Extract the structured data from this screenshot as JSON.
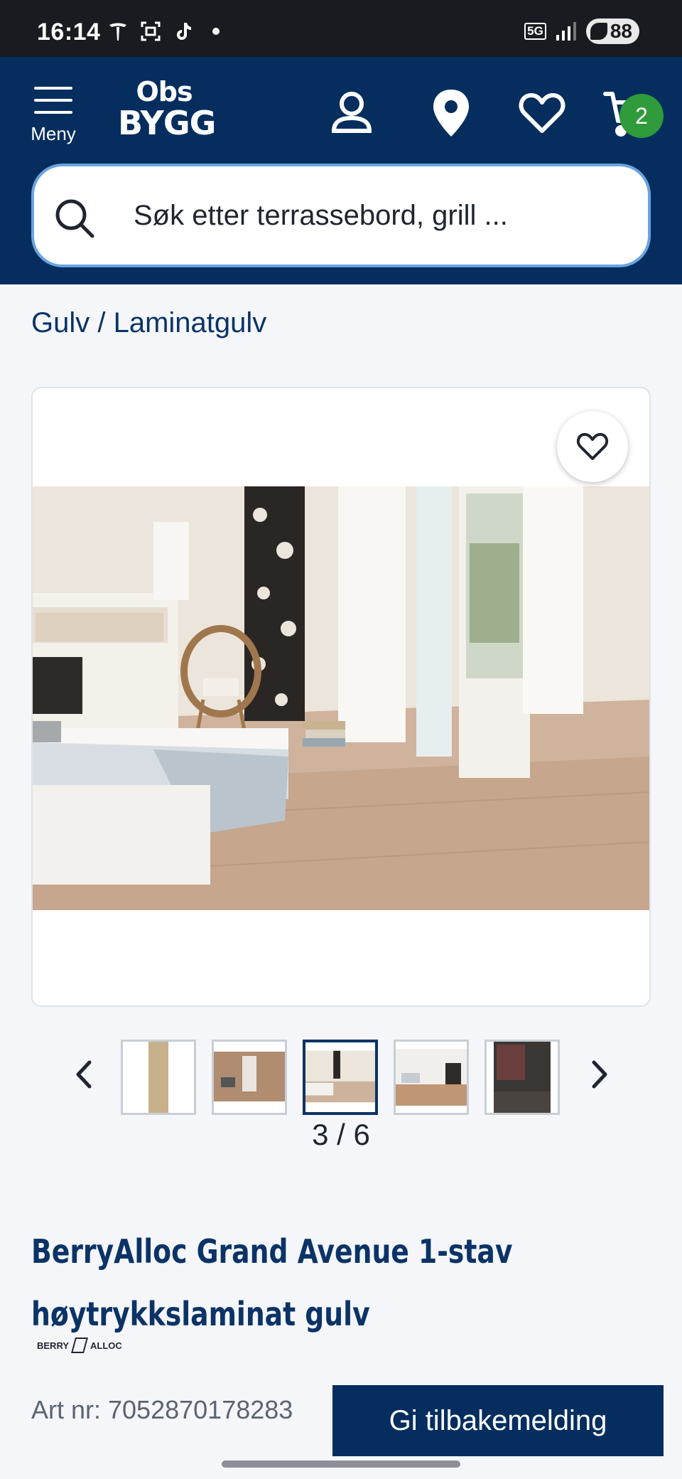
{
  "status_bar": {
    "time": "16:14",
    "left_icons": [
      "tesla-icon",
      "scan-icon",
      "tiktok-icon",
      "dot-icon"
    ],
    "network": "5G",
    "battery": "88"
  },
  "header": {
    "menu_label": "Meny",
    "logo_line1": "Obs",
    "logo_line2": "BYGG",
    "cart_count": "2",
    "accent_color": "#052e5f",
    "badge_color": "#2f9b3a"
  },
  "search": {
    "placeholder": "Søk etter terrassebord, grill ..."
  },
  "breadcrumb": {
    "items": [
      "Gulv",
      "Laminatgulv"
    ],
    "separator": " / "
  },
  "gallery": {
    "counter": "3 / 6",
    "current_index": 3,
    "total": 6,
    "thumbnails": [
      "plank-sample",
      "person-on-floor",
      "bedroom",
      "living-room",
      "dark-room"
    ]
  },
  "product": {
    "title_line1": "BerryAlloc Grand Avenue 1-stav",
    "title_line2": "høytrykkslaminat gulv",
    "brand_left": "BERRY",
    "brand_right": "ALLOC",
    "art_nr": "Art nr: 7052870178283"
  },
  "feedback": {
    "label": "Gi tilbakemelding"
  }
}
